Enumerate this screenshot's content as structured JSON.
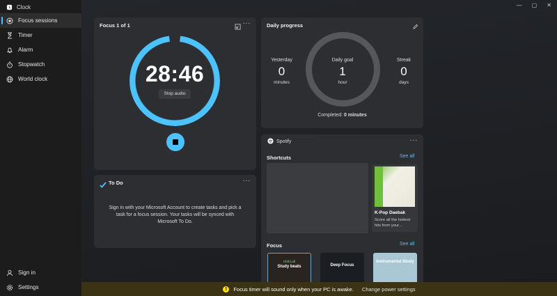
{
  "app": {
    "title": "Clock"
  },
  "window": {
    "minimize": "—",
    "maximize": "▢",
    "close": "✕"
  },
  "sidebar": {
    "items": [
      {
        "label": "Focus sessions",
        "icon": "focus-icon",
        "active": true
      },
      {
        "label": "Timer",
        "icon": "timer-icon"
      },
      {
        "label": "Alarm",
        "icon": "alarm-icon"
      },
      {
        "label": "Stopwatch",
        "icon": "stopwatch-icon"
      },
      {
        "label": "World clock",
        "icon": "globe-icon"
      }
    ],
    "bottom": [
      {
        "label": "Sign in",
        "icon": "person-icon"
      },
      {
        "label": "Settings",
        "icon": "gear-icon"
      }
    ]
  },
  "focus": {
    "title": "Focus 1 of 1",
    "time": "28:46",
    "stop_audio": "Stop audio",
    "progress": 0.96
  },
  "todo": {
    "title": "To Do",
    "message": "Sign in with your Microsoft Account to create tasks and pick a task for a focus session. Your tasks will be synced with Microsoft To Do."
  },
  "daily": {
    "title": "Daily progress",
    "yesterday": {
      "label": "Yesterday",
      "value": "0",
      "unit": "minutes"
    },
    "goal": {
      "label": "Daily goal",
      "value": "1",
      "unit": "hour"
    },
    "streak": {
      "label": "Streak",
      "value": "0",
      "unit": "days"
    },
    "completed_prefix": "Completed: ",
    "completed_value": "0 minutes"
  },
  "spotify": {
    "title": "Spotify",
    "shortcuts": "Shortcuts",
    "see_all": "See all",
    "kpop_name": "K-Pop Daebak",
    "kpop_desc": "Score all the hottest hits from your...",
    "focus": "Focus",
    "tiles": [
      {
        "label": "Study beats",
        "small": "Chill Lofi"
      },
      {
        "label": "Deep Focus"
      },
      {
        "label": "Instrumental Study"
      }
    ]
  },
  "banner": {
    "message": "Focus timer will sound only when your PC is awake.",
    "link": "Change power settings"
  },
  "colors": {
    "accent": "#4cc2ff",
    "warning": "#fce100"
  }
}
